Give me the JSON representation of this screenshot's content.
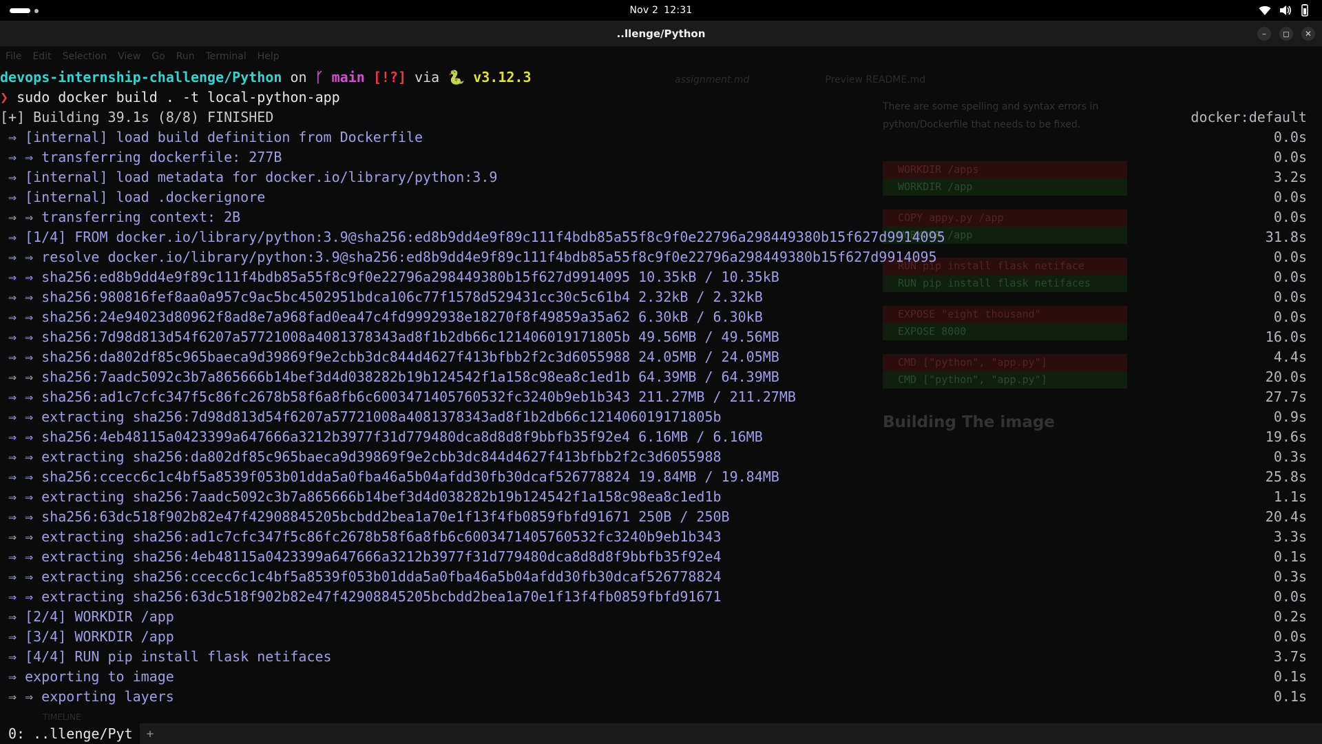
{
  "topbar": {
    "date": "Nov 2",
    "time": "12:31"
  },
  "window": {
    "title": "..llenge/Python",
    "controls": [
      "–",
      "◻",
      "✕"
    ]
  },
  "background_editor": {
    "menu": [
      "File",
      "Edit",
      "Selection",
      "View",
      "Go",
      "Run",
      "Terminal",
      "Help"
    ],
    "tabs": [
      "assignment.md",
      "Preview README.md"
    ],
    "preview_text": "There are some spelling and syntax errors in python/Dockerfile that needs to be fixed.",
    "diff": [
      {
        "type": "del",
        "text": "WORKDIR /apps"
      },
      {
        "type": "add",
        "text": "WORKDIR /app"
      },
      {
        "type": "gap"
      },
      {
        "type": "del",
        "text": "COPY appy.py /app"
      },
      {
        "type": "add",
        "text": "WORKDIR /app"
      },
      {
        "type": "gap"
      },
      {
        "type": "del",
        "text": "RUN pip install flask netiface"
      },
      {
        "type": "add",
        "text": "RUN pip install flask netifaces"
      },
      {
        "type": "gap"
      },
      {
        "type": "del",
        "text": "EXPOSE \"eight thousand\""
      },
      {
        "type": "add",
        "text": "EXPOSE 8000"
      },
      {
        "type": "gap"
      },
      {
        "type": "del",
        "text": "CMD [\"python\", \"app.py\"]"
      },
      {
        "type": "add",
        "text": "CMD [\"python\", \"app.py\"]"
      }
    ],
    "heading": "Building The image",
    "timeline": "TIMELINE"
  },
  "prompt": {
    "dir": "devops-internship-challenge/Python",
    "on": "on",
    "branch_icon": "ᚴ",
    "branch": "main",
    "status": "[!?]",
    "via": "via",
    "lang_icon": "🐍",
    "version": "v3.12.3",
    "chevron": "❯",
    "command": "sudo docker build . -t local-python-app"
  },
  "build": {
    "header": "[+] Building 39.1s (8/8) FINISHED",
    "context": "docker:default",
    "lines": [
      {
        "text": "⇒ [internal] load build definition from Dockerfile",
        "time": "0.0s"
      },
      {
        "text": "⇒ ⇒ transferring dockerfile: 277B",
        "time": "0.0s"
      },
      {
        "text": "⇒ [internal] load metadata for docker.io/library/python:3.9",
        "time": "3.2s"
      },
      {
        "text": "⇒ [internal] load .dockerignore",
        "time": "0.0s"
      },
      {
        "text": "⇒ ⇒ transferring context: 2B",
        "time": "0.0s"
      },
      {
        "text": "⇒ [1/4] FROM docker.io/library/python:3.9@sha256:ed8b9dd4e9f89c111f4bdb85a55f8c9f0e22796a298449380b15f627d9914095",
        "time": "31.8s"
      },
      {
        "text": "⇒ ⇒ resolve docker.io/library/python:3.9@sha256:ed8b9dd4e9f89c111f4bdb85a55f8c9f0e22796a298449380b15f627d9914095",
        "time": "0.0s"
      },
      {
        "text": "⇒ ⇒ sha256:ed8b9dd4e9f89c111f4bdb85a55f8c9f0e22796a298449380b15f627d9914095 10.35kB / 10.35kB",
        "time": "0.0s"
      },
      {
        "text": "⇒ ⇒ sha256:980816fef8aa0a957c9ac5bc4502951bdca106c77f1578d529431cc30c5c61b4 2.32kB / 2.32kB",
        "time": "0.0s"
      },
      {
        "text": "⇒ ⇒ sha256:24e94023d80962f8ad8e7a968fad0ea47c4fd9992938e18270f8f49859a35a62 6.30kB / 6.30kB",
        "time": "0.0s"
      },
      {
        "text": "⇒ ⇒ sha256:7d98d813d54f6207a57721008a4081378343ad8f1b2db66c121406019171805b 49.56MB / 49.56MB",
        "time": "16.0s"
      },
      {
        "text": "⇒ ⇒ sha256:da802df85c965baeca9d39869f9e2cbb3dc844d4627f413bfbb2f2c3d6055988 24.05MB / 24.05MB",
        "time": "4.4s"
      },
      {
        "text": "⇒ ⇒ sha256:7aadc5092c3b7a865666b14bef3d4d038282b19b124542f1a158c98ea8c1ed1b 64.39MB / 64.39MB",
        "time": "20.0s"
      },
      {
        "text": "⇒ ⇒ sha256:ad1c7cfc347f5c86fc2678b58f6a8fb6c6003471405760532fc3240b9eb1b343 211.27MB / 211.27MB",
        "time": "27.7s"
      },
      {
        "text": "⇒ ⇒ extracting sha256:7d98d813d54f6207a57721008a4081378343ad8f1b2db66c121406019171805b",
        "time": "0.9s"
      },
      {
        "text": "⇒ ⇒ sha256:4eb48115a0423399a647666a3212b3977f31d779480dca8d8d8f9bbfb35f92e4 6.16MB / 6.16MB",
        "time": "19.6s"
      },
      {
        "text": "⇒ ⇒ extracting sha256:da802df85c965baeca9d39869f9e2cbb3dc844d4627f413bfbb2f2c3d6055988",
        "time": "0.3s"
      },
      {
        "text": "⇒ ⇒ sha256:ccecc6c1c4bf5a8539f053b01dda5a0fba46a5b04afdd30fb30dcaf526778824 19.84MB / 19.84MB",
        "time": "25.8s"
      },
      {
        "text": "⇒ ⇒ extracting sha256:7aadc5092c3b7a865666b14bef3d4d038282b19b124542f1a158c98ea8c1ed1b",
        "time": "1.1s"
      },
      {
        "text": "⇒ ⇒ sha256:63dc518f902b82e47f42908845205bcbdd2bea1a70e1f13f4fb0859fbfd91671 250B / 250B",
        "time": "20.4s"
      },
      {
        "text": "⇒ ⇒ extracting sha256:ad1c7cfc347f5c86fc2678b58f6a8fb6c6003471405760532fc3240b9eb1b343",
        "time": "3.3s"
      },
      {
        "text": "⇒ ⇒ extracting sha256:4eb48115a0423399a647666a3212b3977f31d779480dca8d8d8f9bbfb35f92e4",
        "time": "0.1s"
      },
      {
        "text": "⇒ ⇒ extracting sha256:ccecc6c1c4bf5a8539f053b01dda5a0fba46a5b04afdd30fb30dcaf526778824",
        "time": "0.3s"
      },
      {
        "text": "⇒ ⇒ extracting sha256:63dc518f902b82e47f42908845205bcbdd2bea1a70e1f13f4fb0859fbfd91671",
        "time": "0.0s"
      },
      {
        "text": "⇒ [2/4] WORKDIR /app",
        "time": "0.2s"
      },
      {
        "text": "⇒ [3/4] WORKDIR /app",
        "time": "0.0s"
      },
      {
        "text": "⇒ [4/4] RUN pip install flask netifaces",
        "time": "3.7s"
      },
      {
        "text": "⇒ exporting to image",
        "time": "0.1s"
      },
      {
        "text": "⇒ ⇒ exporting layers",
        "time": "0.1s"
      }
    ]
  },
  "statusbar": {
    "tab": "0: ..llenge/Pyt",
    "plus": "+"
  },
  "colors": {
    "dir": "#3ecfcf",
    "branch": "#d050d0",
    "status": "#e04040",
    "version": "#e0e040",
    "step": "#9f9fe8"
  }
}
